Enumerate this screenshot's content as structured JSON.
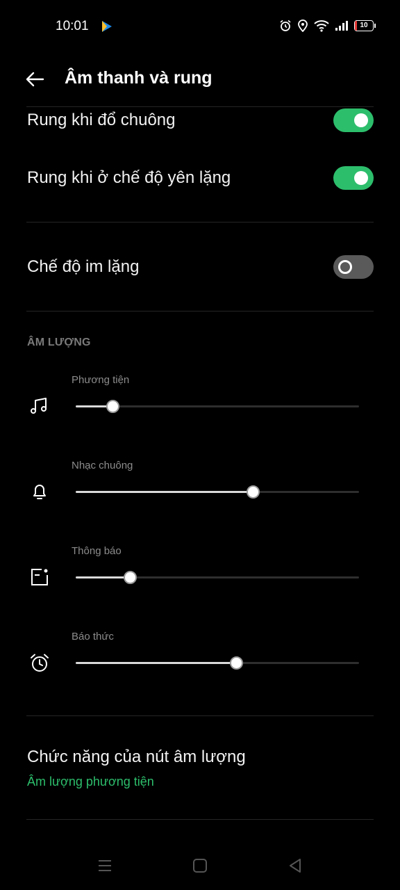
{
  "status_bar": {
    "time": "10:01",
    "battery": "10"
  },
  "header": {
    "title": "Âm thanh và rung"
  },
  "vibration": {
    "ring_label": "Rung khi đổ chuông",
    "ring_on": true,
    "silent_label": "Rung khi ở chế độ yên lặng",
    "silent_on": true
  },
  "silent_mode": {
    "label": "Chế độ im lặng",
    "on": false
  },
  "volume": {
    "section_title": "ÂM LƯỢNG",
    "sliders": [
      {
        "label": "Phương tiện",
        "icon": "music-note-icon",
        "level": 0.13
      },
      {
        "label": "Nhạc chuông",
        "icon": "bell-icon",
        "level": 0.625
      },
      {
        "label": "Thông báo",
        "icon": "notification-icon",
        "level": 0.19
      },
      {
        "label": "Báo thức",
        "icon": "alarm-clock-icon",
        "level": 0.565
      }
    ]
  },
  "volume_button": {
    "label": "Chức năng của nút âm lượng",
    "value": "Âm lượng phương tiện"
  },
  "colors": {
    "accent": "#2dbe6c",
    "background": "#000000"
  }
}
